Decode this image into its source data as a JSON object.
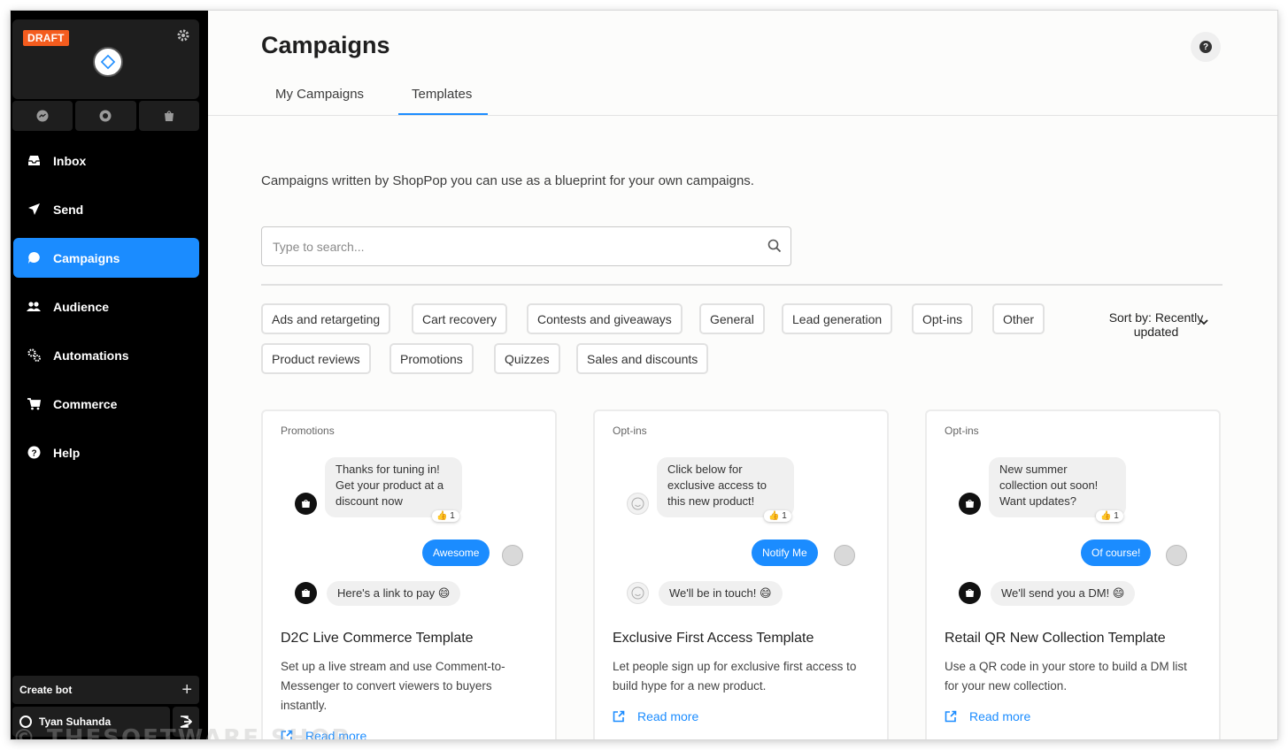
{
  "sidebar": {
    "badge": "DRAFT",
    "nav": [
      {
        "label": "Inbox",
        "icon": "inbox-icon"
      },
      {
        "label": "Send",
        "icon": "send-icon"
      },
      {
        "label": "Campaigns",
        "icon": "campaigns-icon",
        "active": true
      },
      {
        "label": "Audience",
        "icon": "audience-icon"
      },
      {
        "label": "Automations",
        "icon": "automations-icon"
      },
      {
        "label": "Commerce",
        "icon": "cart-icon"
      },
      {
        "label": "Help",
        "icon": "help-icon"
      }
    ],
    "create_bot_label": "Create bot",
    "user_name": "Tyan Suhanda"
  },
  "header": {
    "title": "Campaigns",
    "tabs": [
      {
        "label": "My Campaigns"
      },
      {
        "label": "Templates",
        "active": true
      }
    ]
  },
  "main": {
    "intro": "Campaigns written by ShopPop you can use as a blueprint for your own campaigns.",
    "search_placeholder": "Type to search...",
    "filters": [
      "Ads and retargeting",
      "Cart recovery",
      "Contests and giveaways",
      "General",
      "Lead generation",
      "Opt-ins",
      "Other",
      "Product reviews",
      "Promotions",
      "Quizzes",
      "Sales and discounts"
    ],
    "sort_label": "Sort by: Recently updated"
  },
  "cards": [
    {
      "category": "Promotions",
      "bubble": "Thanks for tuning in! Get your product at a discount now",
      "reaction": "👍 1",
      "reply": "Awesome",
      "followup": "Here's a link to pay 😄",
      "title": "D2C Live Commerce Template",
      "description": "Set up a live stream and use Comment-to-Messenger to convert viewers to buyers instantly.",
      "read_more": "Read more"
    },
    {
      "category": "Opt-ins",
      "bubble": "Click below for exclusive access to this new product!",
      "reaction": "👍 1",
      "reply": "Notify Me",
      "followup": "We'll be in touch! 😄",
      "title": "Exclusive First Access Template",
      "description": "Let people sign up for exclusive first access to build hype for a new product.",
      "read_more": "Read more"
    },
    {
      "category": "Opt-ins",
      "bubble": "New summer collection out soon! Want updates?",
      "reaction": "👍 1",
      "reply": "Of course!",
      "followup": "We'll send you a DM! 😄",
      "title": "Retail QR New Collection Template",
      "description": "Use a QR code in your store to build a DM list for your new collection.",
      "read_more": "Read more"
    }
  ],
  "watermark": "© THESOFTWARE.SHOP",
  "colors": {
    "accent": "#1b8cff",
    "draft": "#f45c1e",
    "sidebar": "#000000"
  }
}
